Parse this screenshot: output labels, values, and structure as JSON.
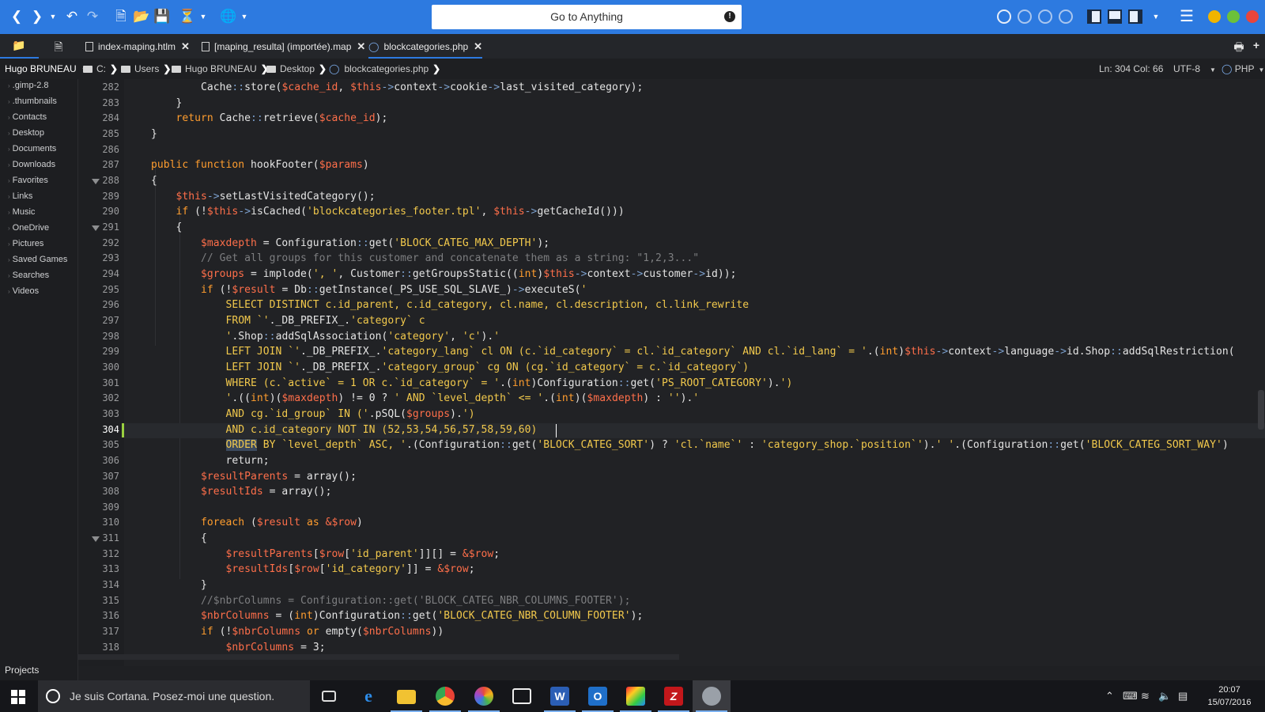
{
  "toolbar": {
    "search_label": "Go to Anything",
    "search_alert": "!"
  },
  "tabs": [
    {
      "label": "index-maping.htlm"
    },
    {
      "label": "[maping_resulta] (importée).map"
    },
    {
      "label": "blockcategories.php"
    }
  ],
  "breadcrumb": {
    "user": "Hugo BRUNEAU",
    "items": [
      "C:",
      "Users",
      "Hugo BRUNEAU",
      "Desktop",
      "blockcategories.php"
    ]
  },
  "status": {
    "position": "Ln: 304 Col: 66",
    "encoding": "UTF-8",
    "language": "PHP"
  },
  "sidebar": {
    "items": [
      ".gimp-2.8",
      ".thumbnails",
      "Contacts",
      "Desktop",
      "Documents",
      "Downloads",
      "Favorites",
      "Links",
      "Music",
      "OneDrive",
      "Pictures",
      "Saved Games",
      "Searches",
      "Videos"
    ],
    "footer": "Projects"
  },
  "editor": {
    "line_numbers": [
      "282",
      "283",
      "284",
      "285",
      "286",
      "287",
      "288",
      "289",
      "290",
      "291",
      "292",
      "293",
      "294",
      "295",
      "296",
      "297",
      "298",
      "299",
      "300",
      "301",
      "302",
      "303",
      "304",
      "305",
      "306",
      "307",
      "308",
      "309",
      "310",
      "311",
      "312",
      "313",
      "314",
      "315",
      "316",
      "317",
      "318"
    ],
    "current_line": "304",
    "folded_lines": [
      "288",
      "291",
      "311"
    ],
    "lines": [
      [
        [
          "        Cache",
          "c-fn"
        ],
        [
          "::",
          "c-op"
        ],
        [
          "store(",
          "c-fn"
        ],
        [
          "$cache_id",
          "c-var"
        ],
        [
          ", ",
          "c-fn"
        ],
        [
          "$this",
          "c-var"
        ],
        [
          "->",
          "c-op"
        ],
        [
          "context",
          "c-fn"
        ],
        [
          "->",
          "c-op"
        ],
        [
          "cookie",
          "c-fn"
        ],
        [
          "->",
          "c-op"
        ],
        [
          "last_visited_category);",
          "c-fn"
        ]
      ],
      [
        [
          "    }",
          "c-fn"
        ]
      ],
      [
        [
          "    ",
          "c-fn"
        ],
        [
          "return",
          "c-kw"
        ],
        [
          " Cache",
          "c-fn"
        ],
        [
          "::",
          "c-op"
        ],
        [
          "retrieve(",
          "c-fn"
        ],
        [
          "$cache_id",
          "c-var"
        ],
        [
          ");",
          "c-fn"
        ]
      ],
      [
        [
          "}",
          "c-fn"
        ]
      ],
      [
        [
          "",
          "c-fn"
        ]
      ],
      [
        [
          "public function",
          "c-kw"
        ],
        [
          " hookFooter(",
          "c-fn"
        ],
        [
          "$params",
          "c-var"
        ],
        [
          ")",
          "c-fn"
        ]
      ],
      [
        [
          "{",
          "c-fn"
        ]
      ],
      [
        [
          "    ",
          "c-fn"
        ],
        [
          "$this",
          "c-var"
        ],
        [
          "->",
          "c-op"
        ],
        [
          "setLastVisitedCategory();",
          "c-fn"
        ]
      ],
      [
        [
          "    ",
          "c-fn"
        ],
        [
          "if",
          "c-kw"
        ],
        [
          " (!",
          "c-fn"
        ],
        [
          "$this",
          "c-var"
        ],
        [
          "->",
          "c-op"
        ],
        [
          "isCached(",
          "c-fn"
        ],
        [
          "'blockcategories_footer.tpl'",
          "c-str"
        ],
        [
          ", ",
          "c-fn"
        ],
        [
          "$this",
          "c-var"
        ],
        [
          "->",
          "c-op"
        ],
        [
          "getCacheId()))",
          "c-fn"
        ]
      ],
      [
        [
          "    {",
          "c-fn"
        ]
      ],
      [
        [
          "        ",
          "c-fn"
        ],
        [
          "$maxdepth",
          "c-var"
        ],
        [
          " = Configuration",
          "c-fn"
        ],
        [
          "::",
          "c-op"
        ],
        [
          "get(",
          "c-fn"
        ],
        [
          "'BLOCK_CATEG_MAX_DEPTH'",
          "c-str"
        ],
        [
          ");",
          "c-fn"
        ]
      ],
      [
        [
          "        // Get all groups for this customer and concatenate them as a string: \"1,2,3...\"",
          "c-cm"
        ]
      ],
      [
        [
          "        ",
          "c-fn"
        ],
        [
          "$groups",
          "c-var"
        ],
        [
          " = implode(",
          "c-fn"
        ],
        [
          "', '",
          "c-str"
        ],
        [
          ", Customer",
          "c-fn"
        ],
        [
          "::",
          "c-op"
        ],
        [
          "getGroupsStatic((",
          "c-fn"
        ],
        [
          "int",
          "c-kw"
        ],
        [
          ")",
          "c-fn"
        ],
        [
          "$this",
          "c-var"
        ],
        [
          "->",
          "c-op"
        ],
        [
          "context",
          "c-fn"
        ],
        [
          "->",
          "c-op"
        ],
        [
          "customer",
          "c-fn"
        ],
        [
          "->",
          "c-op"
        ],
        [
          "id));",
          "c-fn"
        ]
      ],
      [
        [
          "        ",
          "c-fn"
        ],
        [
          "if",
          "c-kw"
        ],
        [
          " (!",
          "c-fn"
        ],
        [
          "$result",
          "c-var"
        ],
        [
          " = Db",
          "c-fn"
        ],
        [
          "::",
          "c-op"
        ],
        [
          "getInstance(_PS_USE_SQL_SLAVE_)",
          "c-fn"
        ],
        [
          "->",
          "c-op"
        ],
        [
          "executeS(",
          "c-fn"
        ],
        [
          "'",
          "c-str"
        ]
      ],
      [
        [
          "            SELECT DISTINCT c.id_parent, c.id_category, cl.name, cl.description, cl.link_rewrite",
          "c-str"
        ]
      ],
      [
        [
          "            FROM `'",
          "c-str"
        ],
        [
          "._DB_PREFIX_.",
          "c-fn"
        ],
        [
          "'category` c",
          "c-str"
        ]
      ],
      [
        [
          "            '",
          "c-str"
        ],
        [
          ".Shop",
          "c-fn"
        ],
        [
          "::",
          "c-op"
        ],
        [
          "addSqlAssociation(",
          "c-fn"
        ],
        [
          "'category'",
          "c-str"
        ],
        [
          ", ",
          "c-fn"
        ],
        [
          "'c'",
          "c-str"
        ],
        [
          ").",
          "c-fn"
        ],
        [
          "'",
          "c-str"
        ]
      ],
      [
        [
          "            LEFT JOIN `'",
          "c-str"
        ],
        [
          "._DB_PREFIX_.",
          "c-fn"
        ],
        [
          "'category_lang` cl ON (c.`id_category` = cl.`id_category` AND cl.`id_lang` = '",
          "c-str"
        ],
        [
          ".(",
          "c-fn"
        ],
        [
          "int",
          "c-kw"
        ],
        [
          ")",
          "c-fn"
        ],
        [
          "$this",
          "c-var"
        ],
        [
          "->",
          "c-op"
        ],
        [
          "context",
          "c-fn"
        ],
        [
          "->",
          "c-op"
        ],
        [
          "language",
          "c-fn"
        ],
        [
          "->",
          "c-op"
        ],
        [
          "id.Shop",
          "c-fn"
        ],
        [
          "::",
          "c-op"
        ],
        [
          "addSqlRestriction(",
          "c-fn"
        ]
      ],
      [
        [
          "            LEFT JOIN `'",
          "c-str"
        ],
        [
          "._DB_PREFIX_.",
          "c-fn"
        ],
        [
          "'category_group` cg ON (cg.`id_category` = c.`id_category`)",
          "c-str"
        ]
      ],
      [
        [
          "            WHERE (c.`active` = 1 OR c.`id_category` = '",
          "c-str"
        ],
        [
          ".(",
          "c-fn"
        ],
        [
          "int",
          "c-kw"
        ],
        [
          ")Configuration",
          "c-fn"
        ],
        [
          "::",
          "c-op"
        ],
        [
          "get(",
          "c-fn"
        ],
        [
          "'PS_ROOT_CATEGORY'",
          "c-str"
        ],
        [
          ").",
          "c-fn"
        ],
        [
          "')",
          "c-str"
        ]
      ],
      [
        [
          "            '",
          "c-str"
        ],
        [
          ".((",
          "c-fn"
        ],
        [
          "int",
          "c-kw"
        ],
        [
          ")(",
          "c-fn"
        ],
        [
          "$maxdepth",
          "c-var"
        ],
        [
          ") != 0 ? ",
          "c-fn"
        ],
        [
          "' AND `level_depth` <= '",
          "c-str"
        ],
        [
          ".(",
          "c-fn"
        ],
        [
          "int",
          "c-kw"
        ],
        [
          ")(",
          "c-fn"
        ],
        [
          "$maxdepth",
          "c-var"
        ],
        [
          ") : ",
          "c-fn"
        ],
        [
          "''",
          "c-str"
        ],
        [
          ").",
          "c-fn"
        ],
        [
          "'",
          "c-str"
        ]
      ],
      [
        [
          "            AND cg.`id_group` IN ('",
          "c-str"
        ],
        [
          ".pSQL(",
          "c-fn"
        ],
        [
          "$groups",
          "c-var"
        ],
        [
          ").",
          "c-fn"
        ],
        [
          "')",
          "c-str"
        ]
      ],
      [
        [
          "            AND c.id_category NOT IN (52,53,54,56,57,58,59,60)",
          "c-str"
        ]
      ],
      [
        [
          "            ",
          "c-str"
        ],
        [
          "ORDER",
          "c-str c-sel"
        ],
        [
          " BY `level_depth` ASC, '",
          "c-str"
        ],
        [
          ".(Configuration",
          "c-fn"
        ],
        [
          "::",
          "c-op"
        ],
        [
          "get(",
          "c-fn"
        ],
        [
          "'BLOCK_CATEG_SORT'",
          "c-str"
        ],
        [
          ") ? ",
          "c-fn"
        ],
        [
          "'cl.`name`'",
          "c-str"
        ],
        [
          " : ",
          "c-fn"
        ],
        [
          "'category_shop.`position`'",
          "c-str"
        ],
        [
          ").",
          "c-fn"
        ],
        [
          "' '",
          "c-str"
        ],
        [
          ".(Configuration",
          "c-fn"
        ],
        [
          "::",
          "c-op"
        ],
        [
          "get(",
          "c-fn"
        ],
        [
          "'BLOCK_CATEG_SORT_WAY'",
          "c-str"
        ],
        [
          ")",
          "c-fn"
        ]
      ],
      [
        [
          "            return;",
          "c-fn"
        ]
      ],
      [
        [
          "        ",
          "c-fn"
        ],
        [
          "$resultParents",
          "c-var"
        ],
        [
          " = array();",
          "c-fn"
        ]
      ],
      [
        [
          "        ",
          "c-fn"
        ],
        [
          "$resultIds",
          "c-var"
        ],
        [
          " = array();",
          "c-fn"
        ]
      ],
      [
        [
          "",
          "c-fn"
        ]
      ],
      [
        [
          "        ",
          "c-fn"
        ],
        [
          "foreach",
          "c-kw"
        ],
        [
          " (",
          "c-fn"
        ],
        [
          "$result",
          "c-var"
        ],
        [
          " as ",
          "c-kw"
        ],
        [
          "&$row",
          "c-var"
        ],
        [
          ")",
          "c-fn"
        ]
      ],
      [
        [
          "        {",
          "c-fn"
        ]
      ],
      [
        [
          "            ",
          "c-fn"
        ],
        [
          "$resultParents",
          "c-var"
        ],
        [
          "[",
          "c-fn"
        ],
        [
          "$row",
          "c-var"
        ],
        [
          "[",
          "c-fn"
        ],
        [
          "'id_parent'",
          "c-str"
        ],
        [
          "]][] = ",
          "c-fn"
        ],
        [
          "&$row",
          "c-var"
        ],
        [
          ";",
          "c-fn"
        ]
      ],
      [
        [
          "            ",
          "c-fn"
        ],
        [
          "$resultIds",
          "c-var"
        ],
        [
          "[",
          "c-fn"
        ],
        [
          "$row",
          "c-var"
        ],
        [
          "[",
          "c-fn"
        ],
        [
          "'id_category'",
          "c-str"
        ],
        [
          "]] = ",
          "c-fn"
        ],
        [
          "&$row",
          "c-var"
        ],
        [
          ";",
          "c-fn"
        ]
      ],
      [
        [
          "        }",
          "c-fn"
        ]
      ],
      [
        [
          "        //$nbrColumns = Configuration::get('BLOCK_CATEG_NBR_COLUMNS_FOOTER');",
          "c-cm"
        ]
      ],
      [
        [
          "        ",
          "c-fn"
        ],
        [
          "$nbrColumns",
          "c-var"
        ],
        [
          " = (",
          "c-fn"
        ],
        [
          "int",
          "c-kw"
        ],
        [
          ")Configuration",
          "c-fn"
        ],
        [
          "::",
          "c-op"
        ],
        [
          "get(",
          "c-fn"
        ],
        [
          "'BLOCK_CATEG_NBR_COLUMN_FOOTER'",
          "c-str"
        ],
        [
          ");",
          "c-fn"
        ]
      ],
      [
        [
          "        ",
          "c-fn"
        ],
        [
          "if",
          "c-kw"
        ],
        [
          " (!",
          "c-fn"
        ],
        [
          "$nbrColumns",
          "c-var"
        ],
        [
          " or ",
          "c-kw"
        ],
        [
          "empty(",
          "c-fn"
        ],
        [
          "$nbrColumns",
          "c-var"
        ],
        [
          "))",
          "c-fn"
        ]
      ],
      [
        [
          "            ",
          "c-fn"
        ],
        [
          "$nbrColumns",
          "c-var"
        ],
        [
          " = 3;",
          "c-fn"
        ]
      ]
    ]
  },
  "taskbar": {
    "cortana_placeholder": "Je suis Cortana. Posez-moi une question.",
    "time": "20:07",
    "date": "15/07/2016"
  }
}
